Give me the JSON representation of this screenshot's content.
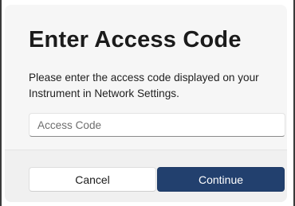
{
  "dialog": {
    "title": "Enter Access Code",
    "message": "Please enter the access code displayed on your Instrument in Network Settings.",
    "access_code_input": {
      "value": "",
      "placeholder": "Access Code"
    },
    "buttons": {
      "cancel_label": "Cancel",
      "continue_label": "Continue"
    }
  },
  "colors": {
    "dialog_background": "#f6f6f6",
    "footer_background": "#f0f0f0",
    "primary_button": "#22406e",
    "title_text": "#1b1b1b"
  }
}
